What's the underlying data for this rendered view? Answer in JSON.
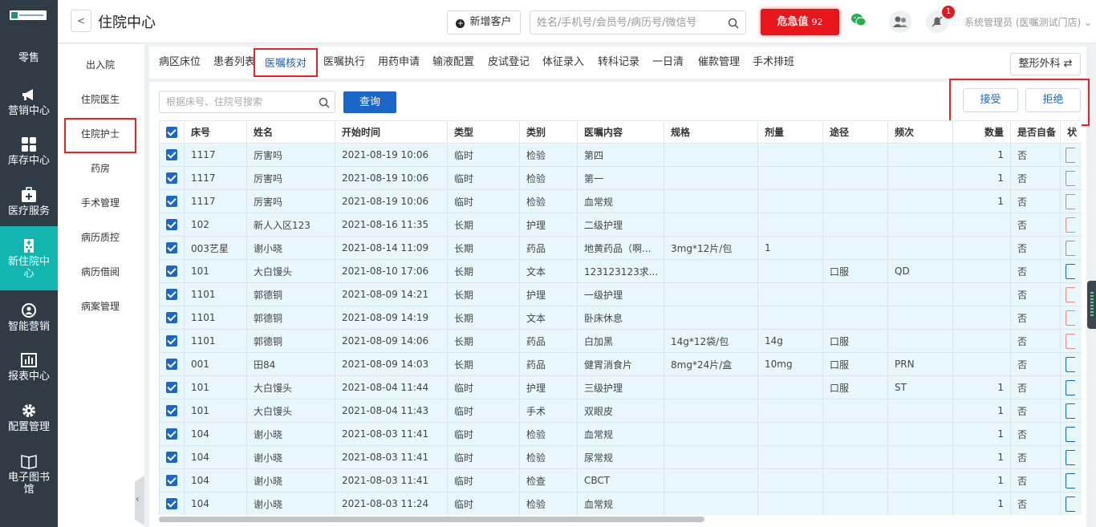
{
  "nav": {
    "items": [
      {
        "label": "零售",
        "icon": "retail-icon",
        "lines": [
          "零售"
        ]
      },
      {
        "label": "营销中心",
        "icon": "megaphone-icon",
        "lines": [
          "营销中心"
        ]
      },
      {
        "label": "库存中心",
        "icon": "grid-icon",
        "lines": [
          "库存中心"
        ]
      },
      {
        "label": "医疗服务",
        "icon": "medical-kit-icon",
        "lines": [
          "医疗服务"
        ]
      },
      {
        "label": "新住院中心",
        "icon": "hospital-icon",
        "lines": [
          "新住院中",
          "心"
        ]
      },
      {
        "label": "智能营销",
        "icon": "smart-marketing-icon",
        "lines": [
          "智能营销"
        ]
      },
      {
        "label": "报表中心",
        "icon": "bar-chart-icon",
        "lines": [
          "报表中心"
        ]
      },
      {
        "label": "配置管理",
        "icon": "gear-icon",
        "lines": [
          "配置管理"
        ]
      },
      {
        "label": "电子图书馆",
        "icon": "book-icon",
        "lines": [
          "电子图书",
          "馆"
        ]
      }
    ],
    "active_index": 4
  },
  "header": {
    "back_glyph": "<",
    "title": "住院中心",
    "add_customer": "新增客户",
    "search_placeholder": "姓名/手机号/会员号/病历号/微信号",
    "critical_label": "危急值",
    "critical_count": "92",
    "bell_badge": "1",
    "user": "系统管理员 (医嘱测试门店)"
  },
  "subnav": {
    "items": [
      "出入院",
      "住院医生",
      "住院护士",
      "药房",
      "手术管理",
      "病历质控",
      "病历借阅",
      "病案管理"
    ],
    "selected_index": 2
  },
  "tabs": {
    "items": [
      "病区床位",
      "患者列表",
      "医嘱核对",
      "医嘱执行",
      "用药申请",
      "输液配置",
      "皮试登记",
      "体征录入",
      "转科记录",
      "一日清",
      "催款管理",
      "手术排班"
    ],
    "selected_index": 2,
    "department": "整形外科"
  },
  "panel": {
    "search_placeholder": "根据床号、住院号搜索",
    "query_button": "查询",
    "accept_button": "接受",
    "reject_button": "拒绝"
  },
  "table": {
    "columns": [
      "床号",
      "姓名",
      "开始时间",
      "类型",
      "类别",
      "医嘱内容",
      "规格",
      "剂量",
      "途径",
      "频次",
      "数量",
      "是否自备",
      "状"
    ],
    "rows": [
      [
        "1117",
        "厉害吗",
        "2021-08-19 10:06",
        "临时",
        "检验",
        "第四",
        "",
        "",
        "",
        "",
        "1",
        "否"
      ],
      [
        "1117",
        "厉害吗",
        "2021-08-19 10:06",
        "临时",
        "检验",
        "第一",
        "",
        "",
        "",
        "",
        "1",
        "否"
      ],
      [
        "1117",
        "厉害吗",
        "2021-08-19 10:06",
        "临时",
        "检验",
        "血常规",
        "",
        "",
        "",
        "",
        "1",
        "否"
      ],
      [
        "102",
        "新人入区123",
        "2021-08-16 11:35",
        "长期",
        "护理",
        "二级护理",
        "",
        "",
        "",
        "",
        "",
        "否"
      ],
      [
        "003艺星",
        "谢小晓",
        "2021-08-14 11:09",
        "长期",
        "药品",
        "地黄药品（啊...",
        "3mg*12片/包",
        "1",
        "",
        "",
        "",
        "否"
      ],
      [
        "101",
        "大白馒头",
        "2021-08-10 17:06",
        "长期",
        "文本",
        "123123123求...",
        "",
        "",
        "口服",
        "QD",
        "",
        "否"
      ],
      [
        "1101",
        "郭德铜",
        "2021-08-09 14:21",
        "长期",
        "护理",
        "一级护理",
        "",
        "",
        "",
        "",
        "",
        "否"
      ],
      [
        "1101",
        "郭德铜",
        "2021-08-09 14:19",
        "长期",
        "文本",
        "卧床休息",
        "",
        "",
        "",
        "",
        "",
        "否"
      ],
      [
        "1101",
        "郭德铜",
        "2021-08-09 14:06",
        "长期",
        "药品",
        "白加黑",
        "14g*12袋/包",
        "14g",
        "口服",
        "",
        "",
        "否"
      ],
      [
        "001",
        "田84",
        "2021-08-09 14:03",
        "长期",
        "药品",
        "健胃消食片",
        "8mg*24片/盒",
        "10mg",
        "口服",
        "PRN",
        "",
        "否"
      ],
      [
        "101",
        "大白馒头",
        "2021-08-04 11:44",
        "临时",
        "护理",
        "三级护理",
        "",
        "",
        "口服",
        "ST",
        "1",
        "否"
      ],
      [
        "101",
        "大白馒头",
        "2021-08-04 11:43",
        "临时",
        "手术",
        "双眼皮",
        "",
        "",
        "",
        "",
        "1",
        "否"
      ],
      [
        "104",
        "谢小晓",
        "2021-08-03 11:41",
        "临时",
        "检验",
        "血常规",
        "",
        "",
        "",
        "",
        "1",
        "否"
      ],
      [
        "104",
        "谢小晓",
        "2021-08-03 11:41",
        "临时",
        "检验",
        "尿常规",
        "",
        "",
        "",
        "",
        "1",
        "否"
      ],
      [
        "104",
        "谢小晓",
        "2021-08-03 11:41",
        "临时",
        "检查",
        "CBCT",
        "",
        "",
        "",
        "",
        "1",
        "否"
      ],
      [
        "104",
        "谢小晓",
        "2021-08-03 11:24",
        "临时",
        "检验",
        "血常规",
        "",
        "",
        "",
        "",
        "1",
        "否"
      ]
    ],
    "status_tag_colors": [
      "#999999",
      "#999999",
      "#999999",
      "#e88a8a",
      "#999999",
      "#1b66c9",
      "#e88a8a",
      "#e88a8a",
      "#e88a8a",
      "#1b66c9",
      "#1b66c9",
      "#1b66c9",
      "#1b66c9",
      "#1b66c9",
      "#1b66c9",
      "#1b66c9"
    ]
  },
  "colors": {
    "sidebar": "#2f3b45",
    "active_nav": "#13b5b1",
    "primary": "#1b66c9",
    "critical": "#e8151b",
    "row_bg": "#e8f7fc",
    "highlight_border": "#e22222"
  }
}
